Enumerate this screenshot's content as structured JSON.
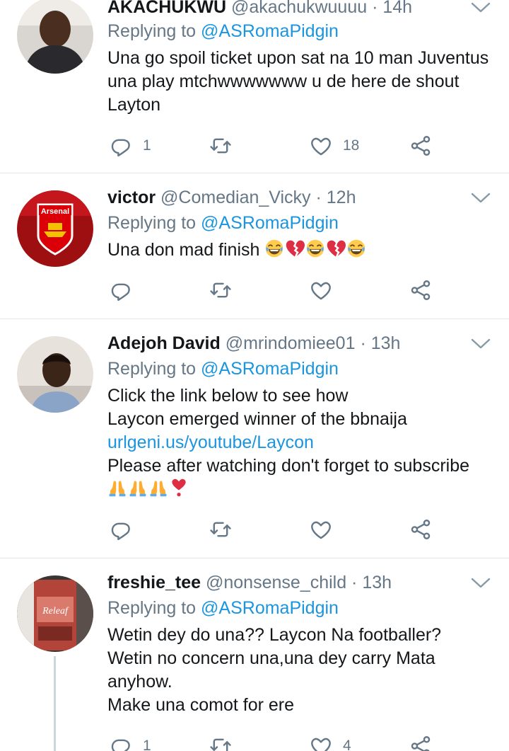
{
  "tweets": [
    {
      "name": "AKACHUKWU",
      "handle": "@akachukwuuuu",
      "time": "14h",
      "replying_prefix": "Replying to ",
      "replying_to": "@ASRomaPidgin",
      "lines": [
        "Una go spoil ticket upon sat na 10 man Juventus",
        "una play mtchwwwwwww u de here de shout",
        "Layton"
      ],
      "reply_count": "1",
      "retweet_count": "",
      "like_count": "18"
    },
    {
      "name": "victor",
      "handle": "@Comedian_Vicky",
      "time": "12h",
      "replying_prefix": "Replying to ",
      "replying_to": "@ASRomaPidgin",
      "lines": [
        "Una don mad finish"
      ],
      "avatar_text": "Arsenal",
      "reply_count": "",
      "retweet_count": "",
      "like_count": ""
    },
    {
      "name": "Adejoh David",
      "handle": "@mrindomiee01",
      "time": "13h",
      "replying_prefix": "Replying to ",
      "replying_to": "@ASRomaPidgin",
      "lines": [
        "Click the link below to see how",
        "Laycon emerged winner of the bbnaija"
      ],
      "link": "urlgeni.us/youtube/Laycon",
      "lines_after": [
        "Please after watching don't forget to subscribe"
      ],
      "reply_count": "",
      "retweet_count": "",
      "like_count": ""
    },
    {
      "name": "freshie_tee",
      "handle": "@nonsense_child",
      "time": "13h",
      "replying_prefix": "Replying to ",
      "replying_to": "@ASRomaPidgin",
      "lines": [
        "Wetin dey do una?? Laycon Na footballer?",
        "Wetin no concern una,una dey carry Mata",
        "anyhow.",
        "Make una comot for ere"
      ],
      "avatar_text": "Releaf",
      "reply_count": "1",
      "retweet_count": "",
      "like_count": "4"
    }
  ],
  "separator": " · ",
  "icons": {
    "reply": "reply-icon",
    "retweet": "retweet-icon",
    "like": "heart-icon",
    "share": "share-icon",
    "more": "chevron-down-icon"
  },
  "colors": {
    "text": "#14171a",
    "secondary": "#657786",
    "link": "#1b95e0",
    "divider": "#e1e8ed"
  }
}
